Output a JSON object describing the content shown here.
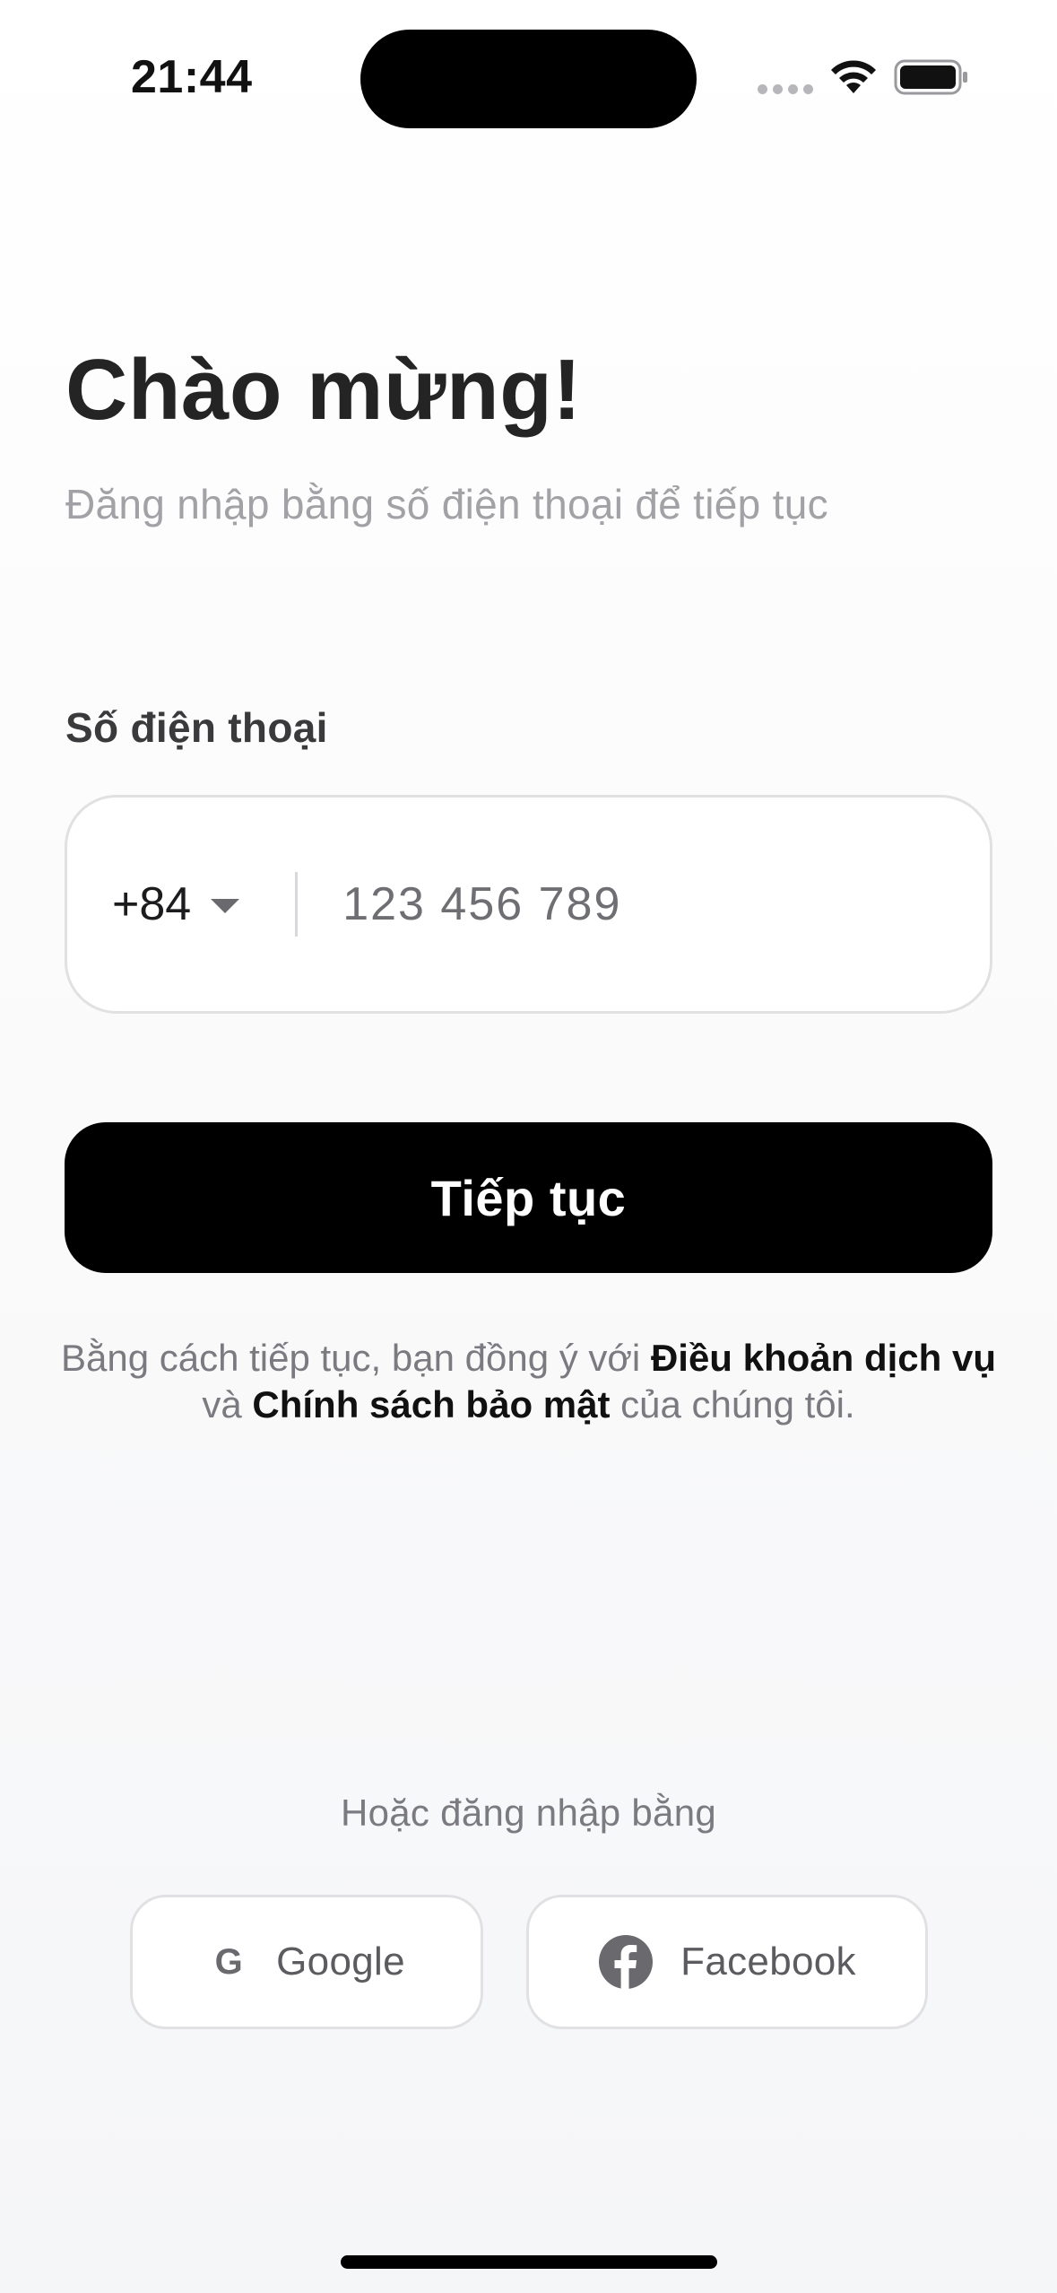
{
  "status_bar": {
    "time": "21:44"
  },
  "welcome": {
    "title": "Chào mừng!",
    "subtitle": "Đăng nhập bằng số điện thoại để tiếp tục"
  },
  "phone": {
    "label": "Số điện thoại",
    "country_code": "+84",
    "placeholder": "123 456 789",
    "value": ""
  },
  "continue_button": "Tiếp tục",
  "terms": {
    "prefix": "Bằng cách tiếp tục, bạn đồng ý với ",
    "terms_link": "Điều khoản dịch vụ",
    "middle": " và ",
    "privacy_link": "Chính sách bảo mật",
    "suffix": " của chúng tôi."
  },
  "social": {
    "divider_text": "Hoặc đăng nhập bằng",
    "google_label": "Google",
    "google_glyph": "G",
    "facebook_label": "Facebook"
  },
  "icons": [
    "wifi-icon",
    "battery-icon",
    "chevron-down-icon",
    "google-icon",
    "facebook-icon"
  ]
}
